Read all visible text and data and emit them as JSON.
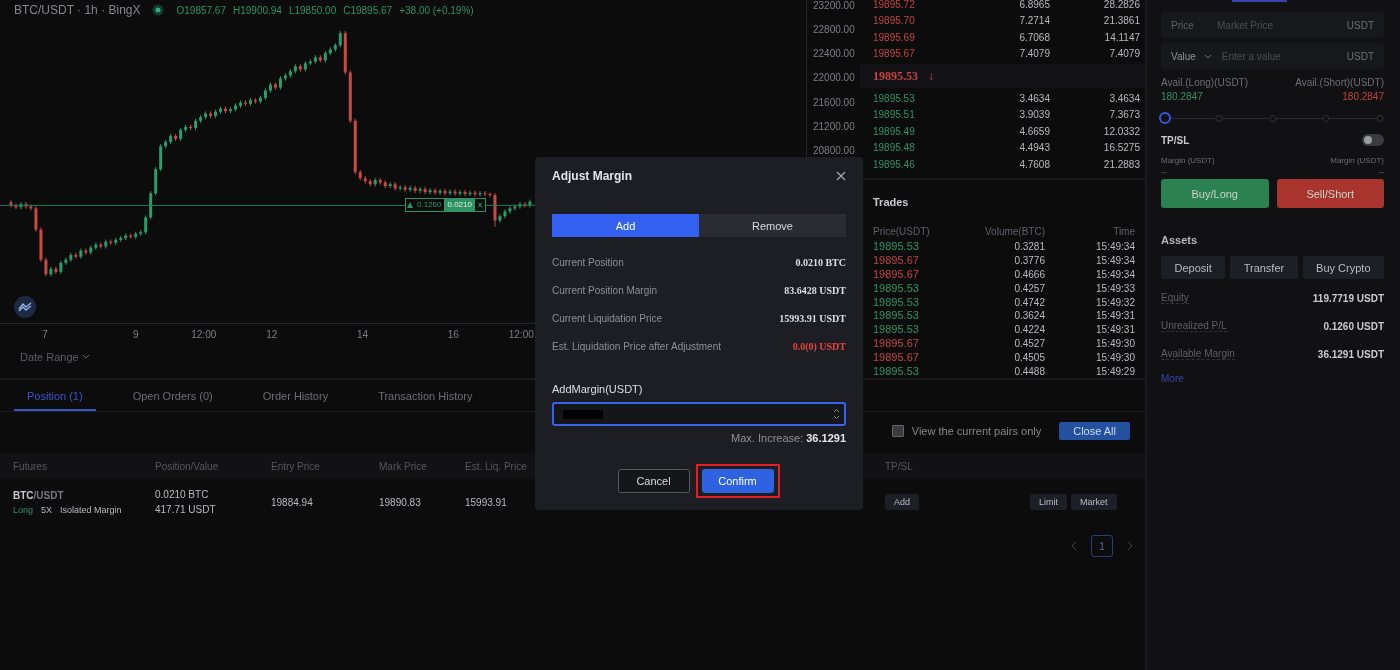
{
  "chart": {
    "symbol": "BTC/USDT · 1h · BingX",
    "ohlc": [
      "O19857.67",
      "H19900.94",
      "L19850.00",
      "C19895.67",
      "+38.00 (+0.19%)"
    ],
    "chart_data": {
      "type": "candlestick",
      "xlim": [
        6.008,
        23.777
      ],
      "ylim": [
        17043,
        23299
      ],
      "ref_lines": [
        {
          "axis": "y",
          "value": 19899
        }
      ],
      "yticks": [
        {
          "value": 23200,
          "label": "23200.00"
        },
        {
          "value": 22800,
          "label": "22800.00"
        },
        {
          "value": 22400,
          "label": "22400.00"
        },
        {
          "value": 22000,
          "label": "22000.00"
        },
        {
          "value": 21600,
          "label": "21600.00"
        },
        {
          "value": 21200,
          "label": "21200.00"
        },
        {
          "value": 20800,
          "label": "20800.00"
        }
      ],
      "xticks": [
        7,
        9,
        12,
        14,
        16
      ],
      "x": [
        6.25,
        6.36,
        6.47,
        6.58,
        6.69,
        6.8,
        6.91,
        7.02,
        7.13,
        7.24,
        7.35,
        7.46,
        7.57,
        7.68,
        7.79,
        7.9,
        8.01,
        8.12,
        8.23,
        8.34,
        8.45,
        8.56,
        8.67,
        8.78,
        8.89,
        9,
        9.11,
        9.22,
        9.33,
        9.44,
        9.55,
        9.66,
        9.77,
        9.88,
        9.99,
        10.1,
        10.21,
        10.32,
        10.43,
        10.54,
        10.65,
        10.76,
        10.87,
        10.98,
        11.09,
        11.2,
        11.31,
        11.42,
        11.53,
        11.64,
        11.75,
        11.86,
        11.97,
        12.08,
        12.19,
        12.3,
        12.41,
        12.52,
        12.63,
        12.74,
        12.85,
        12.96,
        13.07,
        13.18,
        13.29,
        13.4,
        13.51,
        13.62,
        13.73,
        13.84,
        13.95,
        14.06,
        14.17,
        14.28,
        14.39,
        14.5,
        14.61,
        14.72,
        14.83,
        14.94,
        15.05,
        15.16,
        15.27,
        15.38,
        15.49,
        15.6,
        15.71,
        15.82,
        15.93,
        16.04,
        16.15,
        16.26,
        16.37,
        16.48,
        16.59,
        16.7,
        16.81,
        16.92,
        17.03,
        17.14,
        17.25,
        17.36,
        17.47,
        17.58,
        17.69
      ],
      "ohlc": [
        [
          19950,
          19985,
          19865,
          19900
        ],
        [
          19900,
          19935,
          19835,
          19870
        ],
        [
          19870,
          19955,
          19835,
          19920
        ],
        [
          19920,
          19955,
          19845,
          19880
        ],
        [
          19880,
          19915,
          19815,
          19850
        ],
        [
          19850,
          19885,
          19465,
          19500
        ],
        [
          19500,
          19535,
          18965,
          19000
        ],
        [
          19000,
          19035,
          18725,
          18760
        ],
        [
          18760,
          18885,
          18725,
          18850
        ],
        [
          18850,
          18885,
          18765,
          18800
        ],
        [
          18800,
          18985,
          18765,
          18950
        ],
        [
          18950,
          19035,
          18915,
          19000
        ],
        [
          19000,
          19115,
          18965,
          19080
        ],
        [
          19080,
          19115,
          19015,
          19050
        ],
        [
          19050,
          19185,
          19015,
          19150
        ],
        [
          19150,
          19185,
          19085,
          19120
        ],
        [
          19120,
          19235,
          19085,
          19200
        ],
        [
          19200,
          19285,
          19165,
          19250
        ],
        [
          19250,
          19285,
          19185,
          19220
        ],
        [
          19220,
          19335,
          19185,
          19300
        ],
        [
          19300,
          19335,
          19245,
          19280
        ],
        [
          19280,
          19365,
          19245,
          19330
        ],
        [
          19330,
          19395,
          19295,
          19360
        ],
        [
          19360,
          19435,
          19325,
          19400
        ],
        [
          19400,
          19435,
          19345,
          19380
        ],
        [
          19380,
          19465,
          19345,
          19430
        ],
        [
          19430,
          19490,
          19395,
          19455
        ],
        [
          19455,
          19735,
          19420,
          19700
        ],
        [
          19700,
          20135,
          19665,
          20100
        ],
        [
          20100,
          20535,
          20065,
          20500
        ],
        [
          20500,
          20915,
          20465,
          20880
        ],
        [
          20880,
          20985,
          20845,
          20950
        ],
        [
          20950,
          21085,
          20915,
          21050
        ],
        [
          21050,
          21085,
          20965,
          21000
        ],
        [
          21000,
          21185,
          20965,
          21150
        ],
        [
          21150,
          21235,
          21115,
          21200
        ],
        [
          21200,
          21235,
          21145,
          21180
        ],
        [
          21180,
          21335,
          21145,
          21300
        ],
        [
          21300,
          21395,
          21265,
          21360
        ],
        [
          21360,
          21455,
          21325,
          21420
        ],
        [
          21420,
          21455,
          21345,
          21380
        ],
        [
          21380,
          21485,
          21345,
          21450
        ],
        [
          21450,
          21535,
          21415,
          21500
        ],
        [
          21500,
          21535,
          21425,
          21460
        ],
        [
          21460,
          21525,
          21425,
          21490
        ],
        [
          21490,
          21585,
          21455,
          21550
        ],
        [
          21550,
          21635,
          21515,
          21600
        ],
        [
          21600,
          21635,
          21545,
          21580
        ],
        [
          21580,
          21675,
          21545,
          21640
        ],
        [
          21640,
          21675,
          21585,
          21620
        ],
        [
          21620,
          21715,
          21585,
          21680
        ],
        [
          21680,
          21835,
          21645,
          21800
        ],
        [
          21800,
          21935,
          21765,
          21900
        ],
        [
          21900,
          21935,
          21815,
          21850
        ],
        [
          21850,
          22035,
          21815,
          22000
        ],
        [
          22000,
          22085,
          21965,
          22050
        ],
        [
          22050,
          22155,
          22015,
          22120
        ],
        [
          22120,
          22235,
          22085,
          22200
        ],
        [
          22200,
          22235,
          22115,
          22150
        ],
        [
          22150,
          22285,
          22115,
          22250
        ],
        [
          22250,
          22315,
          22215,
          22280
        ],
        [
          22280,
          22385,
          22245,
          22350
        ],
        [
          22350,
          22385,
          22265,
          22300
        ],
        [
          22300,
          22455,
          22265,
          22420
        ],
        [
          22420,
          22515,
          22385,
          22480
        ],
        [
          22480,
          22585,
          22445,
          22550
        ],
        [
          22550,
          22785,
          22515,
          22750
        ],
        [
          22750,
          22785,
          22065,
          22100
        ],
        [
          22100,
          22135,
          21265,
          21300
        ],
        [
          21300,
          21335,
          20415,
          20450
        ],
        [
          20450,
          20485,
          20315,
          20350
        ],
        [
          20350,
          20385,
          20265,
          20300
        ],
        [
          20300,
          20335,
          20215,
          20250
        ],
        [
          20250,
          20355,
          20215,
          20320
        ],
        [
          20320,
          20355,
          20245,
          20280
        ],
        [
          20280,
          20315,
          20185,
          20220
        ],
        [
          20220,
          20285,
          20185,
          20250
        ],
        [
          20250,
          20285,
          20145,
          20180
        ],
        [
          20180,
          20235,
          20145,
          20200
        ],
        [
          20200,
          20235,
          20125,
          20160
        ],
        [
          20160,
          20225,
          20125,
          20190
        ],
        [
          20190,
          20225,
          20105,
          20140
        ],
        [
          20140,
          20205,
          20105,
          20170
        ],
        [
          20170,
          20205,
          20085,
          20120
        ],
        [
          20120,
          20185,
          20085,
          20150
        ],
        [
          20150,
          20185,
          20075,
          20110
        ],
        [
          20110,
          20175,
          20075,
          20140
        ],
        [
          20140,
          20175,
          20065,
          20100
        ],
        [
          20100,
          20165,
          20065,
          20130
        ],
        [
          20130,
          20165,
          20060,
          20095
        ],
        [
          20095,
          20155,
          20060,
          20120
        ],
        [
          20120,
          20155,
          20055,
          20090
        ],
        [
          20090,
          20145,
          20055,
          20110
        ],
        [
          20110,
          20145,
          20050,
          20085
        ],
        [
          20085,
          20135,
          20050,
          20100
        ],
        [
          20100,
          20135,
          20055,
          20090
        ],
        [
          20090,
          20110,
          20040,
          20070
        ],
        [
          20070,
          20105,
          19545,
          19650
        ],
        [
          19650,
          19755,
          19615,
          19720
        ],
        [
          19720,
          19835,
          19685,
          19800
        ],
        [
          19800,
          19885,
          19765,
          19850
        ],
        [
          19850,
          19915,
          19815,
          19880
        ],
        [
          19880,
          19955,
          19845,
          19920
        ],
        [
          19920,
          19955,
          19865,
          19900
        ],
        [
          19900,
          19995,
          19865,
          19960
        ]
      ]
    },
    "noon_labels": [
      "12:00",
      "12:00"
    ],
    "marker": {
      "pnl": "0.1260",
      "size": "0.0210"
    },
    "date_range": "Date Range"
  },
  "order_book": {
    "asks": [
      {
        "price": "19895.72",
        "amount": "6.8965",
        "total": "28.2826"
      },
      {
        "price": "19895.70",
        "amount": "7.2714",
        "total": "21.3861"
      },
      {
        "price": "19895.69",
        "amount": "6.7068",
        "total": "14.1147"
      },
      {
        "price": "19895.67",
        "amount": "7.4079",
        "total": "7.4079"
      }
    ],
    "last_price": "19895.53",
    "last_arrow": "↓",
    "bids": [
      {
        "price": "19895.53",
        "amount": "3.4634",
        "total": "3.4634"
      },
      {
        "price": "19895.51",
        "amount": "3.9039",
        "total": "7.3673"
      },
      {
        "price": "19895.49",
        "amount": "4.6659",
        "total": "12.0332"
      },
      {
        "price": "19895.48",
        "amount": "4.4943",
        "total": "16.5275"
      },
      {
        "price": "19895.46",
        "amount": "4.7608",
        "total": "21.2883"
      }
    ]
  },
  "trades": {
    "title": "Trades",
    "columns": [
      "Price(USDT)",
      "Volume(BTC)",
      "Time"
    ],
    "rows": [
      {
        "price": "19895.53",
        "volume": "0.3281",
        "time": "15:49:34",
        "color": "#2f9263"
      },
      {
        "price": "19895.67",
        "volume": "0.3776",
        "time": "15:49:34",
        "color": "#c2443d"
      },
      {
        "price": "19895.67",
        "volume": "0.4666",
        "time": "15:49:34",
        "color": "#c2443d"
      },
      {
        "price": "19895.53",
        "volume": "0.4257",
        "time": "15:49:33",
        "color": "#2f9263"
      },
      {
        "price": "19895.53",
        "volume": "0.4742",
        "time": "15:49:32",
        "color": "#2f9263"
      },
      {
        "price": "19895.53",
        "volume": "0.3624",
        "time": "15:49:31",
        "color": "#2f9263"
      },
      {
        "price": "19895.53",
        "volume": "0.4224",
        "time": "15:49:31",
        "color": "#2f9263"
      },
      {
        "price": "19895.67",
        "volume": "0.4527",
        "time": "15:49:30",
        "color": "#c2443d"
      },
      {
        "price": "19895.67",
        "volume": "0.4505",
        "time": "15:49:30",
        "color": "#c2443d"
      },
      {
        "price": "19895.53",
        "volume": "0.4488",
        "time": "15:49:29",
        "color": "#2f9263"
      }
    ]
  },
  "order_form": {
    "price_field": {
      "label": "Price",
      "placeholder": "Market Price",
      "unit": "USDT"
    },
    "value_field": {
      "label": "Value",
      "placeholder": "Enter a value",
      "unit": "USDT"
    },
    "avail_long": {
      "label": "Avail.(Long)(USDT)",
      "value": "180.2847"
    },
    "avail_short": {
      "label": "Avail.(Short)(USDT)",
      "value": "180.2847"
    },
    "slider": {
      "level": 0
    },
    "tpsl": {
      "label": "TP/SL",
      "on": false
    },
    "margin_long": {
      "label": "Margin (USDT)",
      "value": "--"
    },
    "margin_short": {
      "label": "Margin (USDT)",
      "value": "--"
    },
    "buttons": [
      {
        "label": "Buy/Long",
        "kind": "buy"
      },
      {
        "label": "Sell/Short",
        "kind": "sell"
      }
    ],
    "assets": {
      "title": "Assets",
      "actions": [
        "Deposit",
        "Transfer",
        "Buy Crypto"
      ],
      "stats": [
        {
          "label": "Equity",
          "value": "119.7719 USDT"
        },
        {
          "label": "Unrealized P/L",
          "value": "0.1260 USDT"
        },
        {
          "label": "Available Margin",
          "value": "36.1291 USDT"
        }
      ],
      "more": "More"
    }
  },
  "positions": {
    "tabs": [
      {
        "label": "Position (1)",
        "selected": true
      },
      {
        "label": "Open Orders (0)",
        "selected": false
      },
      {
        "label": "Order History",
        "selected": false
      },
      {
        "label": "Transaction History",
        "selected": false
      }
    ],
    "filter": {
      "label": "View the current pairs only",
      "checked": false
    },
    "close_all": "Close All",
    "columns": [
      "Futures",
      "Position/Value",
      "Entry Price",
      "Mark Price",
      "Est. Liq. Price",
      "TP/SL"
    ],
    "rows": [
      {
        "pair": "**BTC**/USDT",
        "side": "Long",
        "leverage": "5X",
        "margin_mode": "Isolated Margin",
        "position": "0.0210 BTC",
        "value": "417.71 USDT",
        "entry": "19884.94",
        "mark": "19890.83",
        "liq": "15993.91",
        "tpsl_action": "Add",
        "close_actions": [
          "Limit",
          "Market"
        ]
      }
    ],
    "pages": [
      {
        "label": "1",
        "selected": true
      }
    ]
  },
  "dialog": {
    "title": "Adjust Margin",
    "modes": [
      {
        "label": "Add",
        "selected": true
      },
      {
        "label": "Remove",
        "selected": false
      }
    ],
    "details": [
      {
        "label": "Current Position",
        "value": "0.0210 BTC",
        "alert": false
      },
      {
        "label": "Current Position Margin",
        "value": "83.6428 USDT",
        "alert": false
      },
      {
        "label": "Current Liquidation Price",
        "value": "15993.91 USDT",
        "alert": false
      },
      {
        "label": "Est. Liquidation Price after Adjustment",
        "value": "0.0(0) USDT",
        "alert": true
      }
    ],
    "input_label": "AddMargin(USDT)",
    "max_label": "Max. Increase:",
    "max_value": "36.1291",
    "buttons": [
      {
        "label": "Cancel",
        "kind": "secondary",
        "highlighted": false
      },
      {
        "label": "Confirm",
        "kind": "primary",
        "highlighted": true
      }
    ]
  }
}
